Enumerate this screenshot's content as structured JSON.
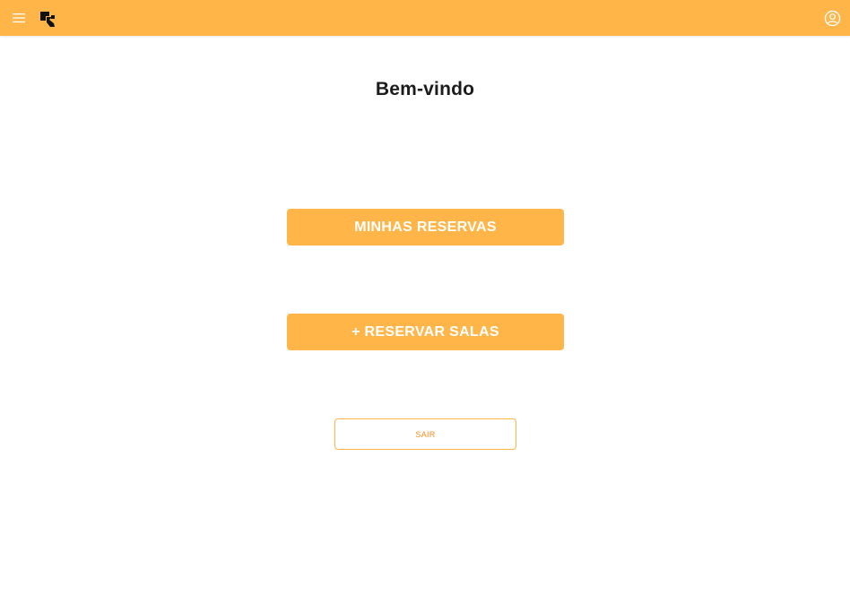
{
  "header": {
    "menu_icon": "hamburger-menu-icon",
    "logo_icon": "brand-logo-icon",
    "user_icon": "user-account-icon",
    "background_color": "#FFB547"
  },
  "main": {
    "title": "Bem-vindo",
    "my_reservations_label": "MINHAS RESERVAS",
    "reserve_rooms_label": "+ RESERVAR SALAS",
    "logout_label": "SAIR"
  },
  "colors": {
    "accent": "#FFB547",
    "logout_text": "#FF8C1A",
    "primary_text": "#1C1C1C"
  }
}
